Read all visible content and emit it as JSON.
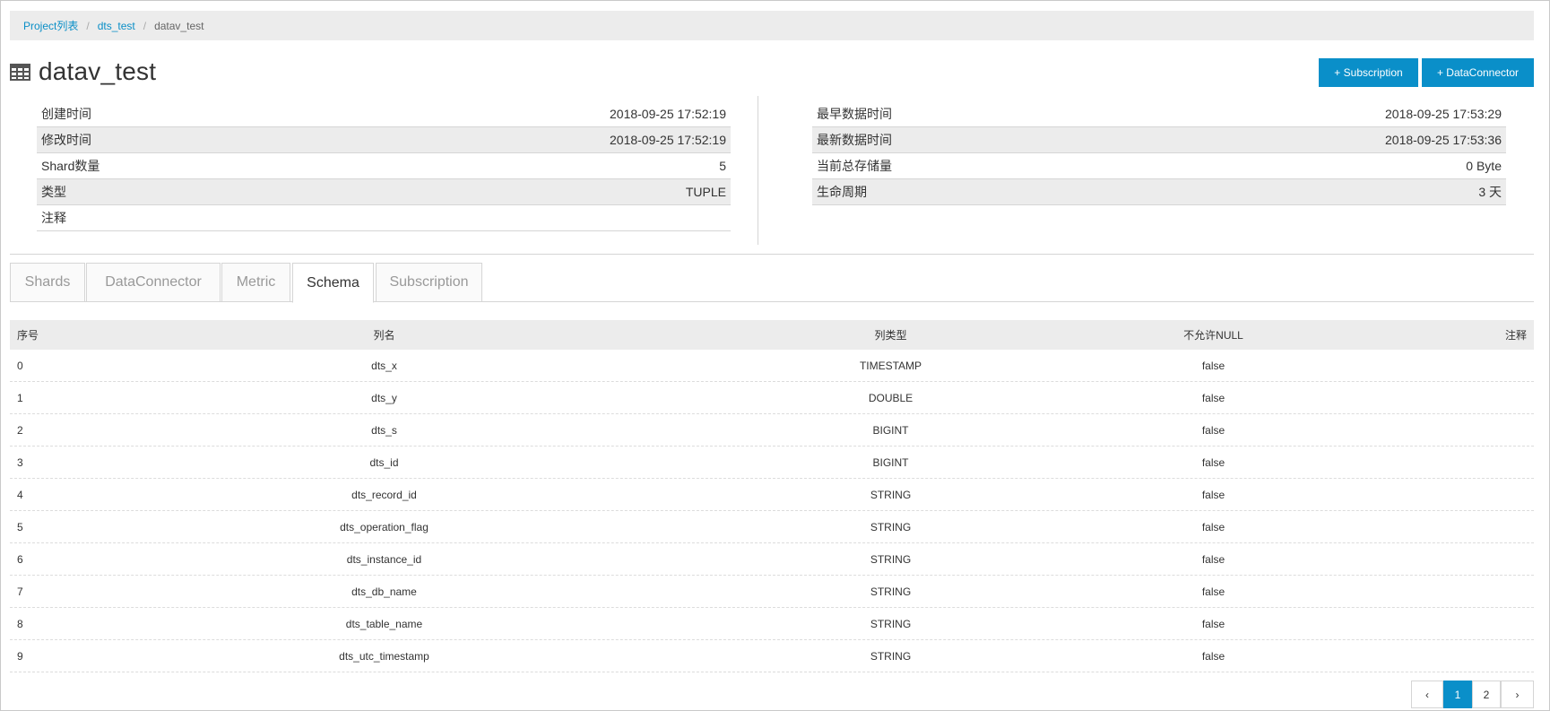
{
  "breadcrumb": {
    "items": [
      "Project列表",
      "dts_test"
    ],
    "current": "datav_test"
  },
  "page": {
    "title": "datav_test"
  },
  "buttons": {
    "subscription": "+ Subscription",
    "dataconnector": "+ DataConnector"
  },
  "info_left": [
    {
      "label": "创建时间",
      "value": "2018-09-25 17:52:19"
    },
    {
      "label": "修改时间",
      "value": "2018-09-25 17:52:19"
    },
    {
      "label": "Shard数量",
      "value": "5"
    },
    {
      "label": "类型",
      "value": "TUPLE"
    },
    {
      "label": "注释",
      "value": ""
    }
  ],
  "info_right": [
    {
      "label": "最早数据时间",
      "value": "2018-09-25 17:53:29"
    },
    {
      "label": "最新数据时间",
      "value": "2018-09-25 17:53:36"
    },
    {
      "label": "当前总存储量",
      "value": "0 Byte"
    },
    {
      "label": "生命周期",
      "value": "3 天"
    }
  ],
  "tabs": [
    "Shards",
    "DataConnector",
    "Metric",
    "Schema",
    "Subscription"
  ],
  "active_tab": "Schema",
  "schema": {
    "headers": [
      "序号",
      "列名",
      "列类型",
      "不允许NULL",
      "注释"
    ],
    "rows": [
      [
        "0",
        "dts_x",
        "TIMESTAMP",
        "false",
        ""
      ],
      [
        "1",
        "dts_y",
        "DOUBLE",
        "false",
        ""
      ],
      [
        "2",
        "dts_s",
        "BIGINT",
        "false",
        ""
      ],
      [
        "3",
        "dts_id",
        "BIGINT",
        "false",
        ""
      ],
      [
        "4",
        "dts_record_id",
        "STRING",
        "false",
        ""
      ],
      [
        "5",
        "dts_operation_flag",
        "STRING",
        "false",
        ""
      ],
      [
        "6",
        "dts_instance_id",
        "STRING",
        "false",
        ""
      ],
      [
        "7",
        "dts_db_name",
        "STRING",
        "false",
        ""
      ],
      [
        "8",
        "dts_table_name",
        "STRING",
        "false",
        ""
      ],
      [
        "9",
        "dts_utc_timestamp",
        "STRING",
        "false",
        ""
      ]
    ]
  },
  "pagination": {
    "prev": "‹",
    "pages": [
      "1",
      "2"
    ],
    "current": "1",
    "next": "›"
  },
  "colors": {
    "accent": "#0a8fc9",
    "link": "#0b8fc7",
    "row_alt": "#ececec"
  }
}
